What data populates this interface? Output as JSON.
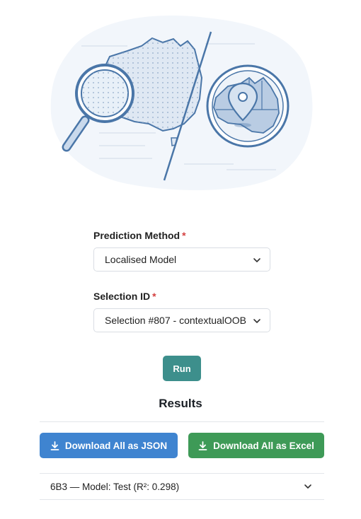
{
  "form": {
    "prediction_method": {
      "label": "Prediction Method",
      "required_mark": "*",
      "value": "Localised Model"
    },
    "selection_id": {
      "label": "Selection ID",
      "required_mark": "*",
      "value": "Selection #807 - contextualOOB"
    }
  },
  "actions": {
    "run_label": "Run"
  },
  "results": {
    "title": "Results",
    "download_json_label": "Download All as JSON",
    "download_excel_label": "Download All as Excel",
    "items": [
      {
        "label": "6B3 — Model: Test (R²: 0.298)"
      }
    ]
  },
  "colors": {
    "run": "#3d8f8c",
    "download_json": "#3f84d0",
    "download_excel": "#3e9a57",
    "required": "#d33f3f",
    "illustration_stroke": "#4a76a8",
    "illustration_fill": "#c9d9ec"
  }
}
